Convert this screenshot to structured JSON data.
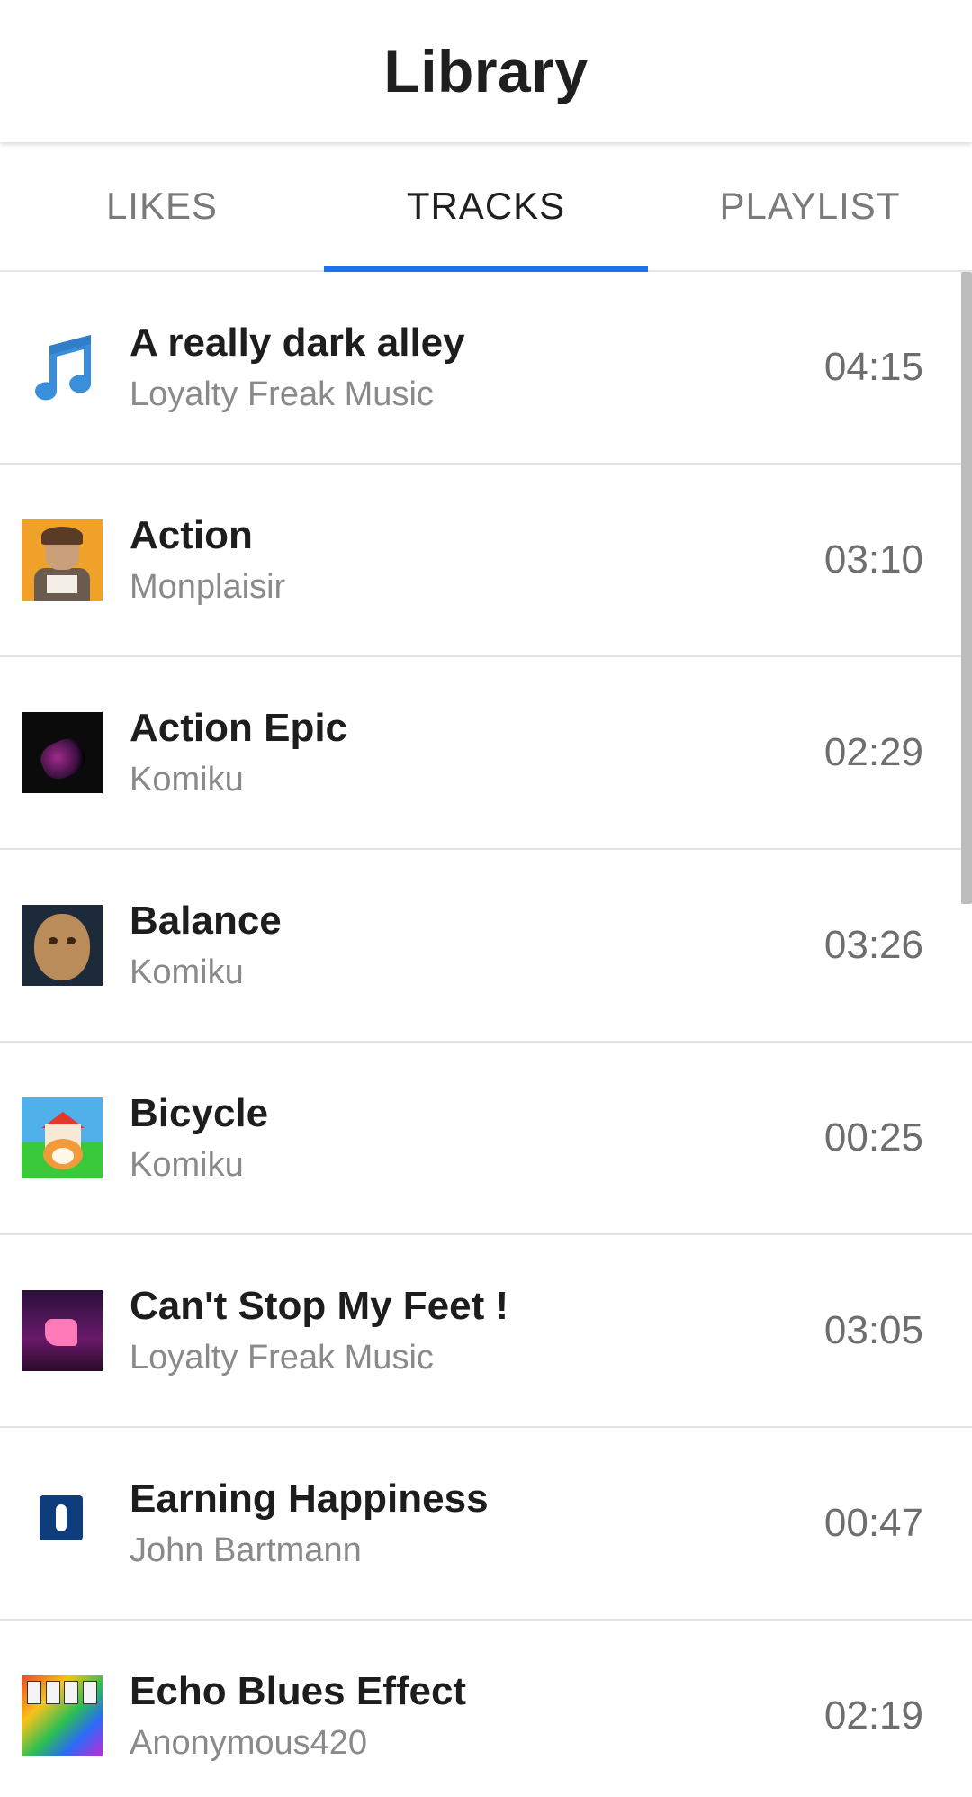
{
  "header": {
    "title": "Library"
  },
  "tabs": [
    {
      "label": "LIKES",
      "active": false
    },
    {
      "label": "TRACKS",
      "active": true
    },
    {
      "label": "PLAYLIST",
      "active": false
    }
  ],
  "tracks": [
    {
      "title": "A really dark alley",
      "artist": "Loyalty Freak Music",
      "duration": "04:15",
      "art": "music-note-icon"
    },
    {
      "title": "Action",
      "artist": "Monplaisir",
      "duration": "03:10",
      "art": "album-art-action"
    },
    {
      "title": "Action Epic",
      "artist": "Komiku",
      "duration": "02:29",
      "art": "album-art-action-epic"
    },
    {
      "title": "Balance",
      "artist": "Komiku",
      "duration": "03:26",
      "art": "album-art-balance"
    },
    {
      "title": "Bicycle",
      "artist": "Komiku",
      "duration": "00:25",
      "art": "album-art-bicycle"
    },
    {
      "title": "Can't Stop My Feet !",
      "artist": "Loyalty Freak Music",
      "duration": "03:05",
      "art": "album-art-cant-stop-my-feet"
    },
    {
      "title": "Earning Happiness",
      "artist": "John Bartmann",
      "duration": "00:47",
      "art": "album-art-earning-happiness"
    },
    {
      "title": "Echo Blues Effect",
      "artist": "Anonymous420",
      "duration": "02:19",
      "art": "album-art-echo-blues-effect"
    }
  ],
  "colors": {
    "accent": "#1a73e8",
    "note_icon": "#3a8fdc",
    "title_text": "#1d1d1d",
    "secondary_text": "#8a8a8a",
    "divider": "#e3e3e3"
  }
}
